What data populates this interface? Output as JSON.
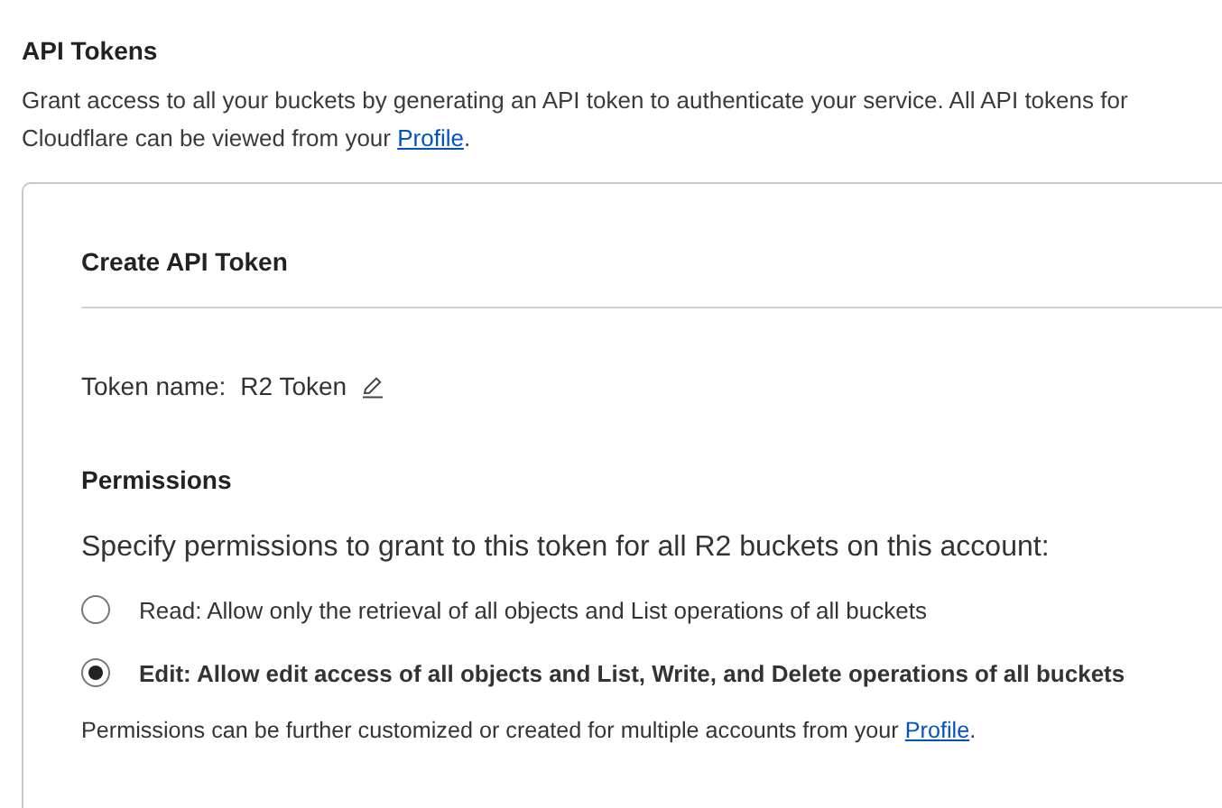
{
  "section": {
    "title": "API Tokens",
    "description": {
      "text": "Grant access to all your buckets by generating an API token to authenticate your service. All API tokens for Cloudflare can be viewed from your ",
      "link": "Profile",
      "after": "."
    }
  },
  "card": {
    "title": "Create API Token",
    "token_name": {
      "label": "Token name:",
      "value": "R2 Token"
    },
    "permissions": {
      "title": "Permissions",
      "prompt": "Specify permissions to grant to this token for all R2 buckets on this account:",
      "options": [
        {
          "label": "Read: Allow only the retrieval of all objects and List operations of all buckets",
          "selected": false
        },
        {
          "label": "Edit: Allow edit access of all objects and List, Write, and Delete operations of all buckets",
          "selected": true
        }
      ],
      "note": {
        "text": "Permissions can be further customized or created for multiple accounts from your ",
        "link": "Profile",
        "after": "."
      }
    }
  }
}
